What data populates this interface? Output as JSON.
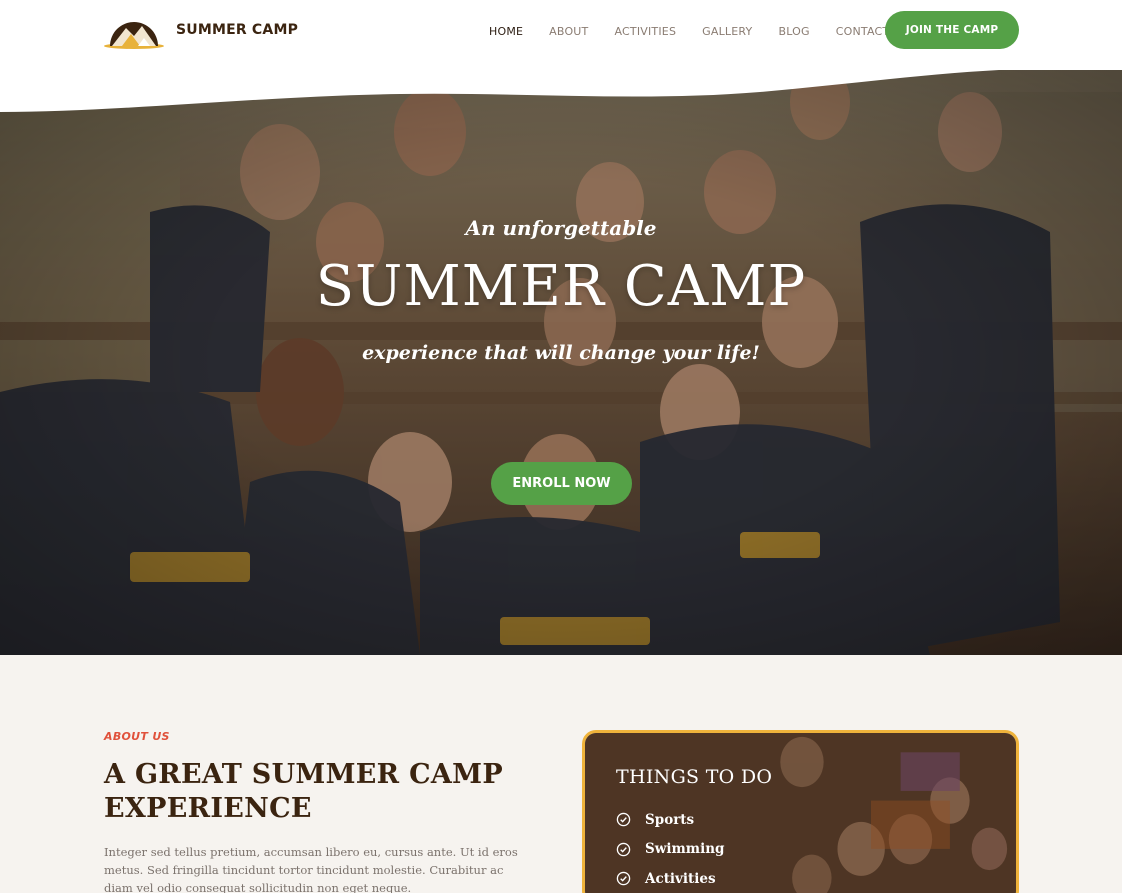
{
  "brand": {
    "name": "SUMMER CAMP",
    "logo_icon": "mountain-tent-icon"
  },
  "nav": {
    "items": [
      {
        "label": "HOME",
        "active": true
      },
      {
        "label": "ABOUT",
        "active": false
      },
      {
        "label": "ACTIVITIES",
        "active": false
      },
      {
        "label": "GALLERY",
        "active": false
      },
      {
        "label": "BLOG",
        "active": false
      },
      {
        "label": "CONTACT",
        "active": false
      }
    ],
    "cta_label": "JOIN THE CAMP"
  },
  "hero": {
    "intro": "An unforgettable",
    "title": "SUMMER CAMP",
    "subtitle": "experience that will change your life!",
    "button_label": "ENROLL NOW"
  },
  "about": {
    "label": "ABOUT US",
    "title": "A GREAT SUMMER CAMP EXPERIENCE",
    "body": "Integer sed tellus pretium, accumsan libero eu, cursus ante. Ut id eros metus. Sed fringilla tincidunt tortor tincidunt molestie. Curabitur ac diam vel odio consequat sollicitudin non eget neque."
  },
  "things_to_do": {
    "title": "THINGS TO DO",
    "items": [
      "Sports",
      "Swimming",
      "Activities"
    ],
    "item_icon": "check-circle-icon"
  },
  "colors": {
    "accent_green": "#55a147",
    "brand_brown": "#3b2410",
    "label_red": "#e0513b",
    "card_border": "#efb33b",
    "page_bg": "#f6f3ef"
  }
}
